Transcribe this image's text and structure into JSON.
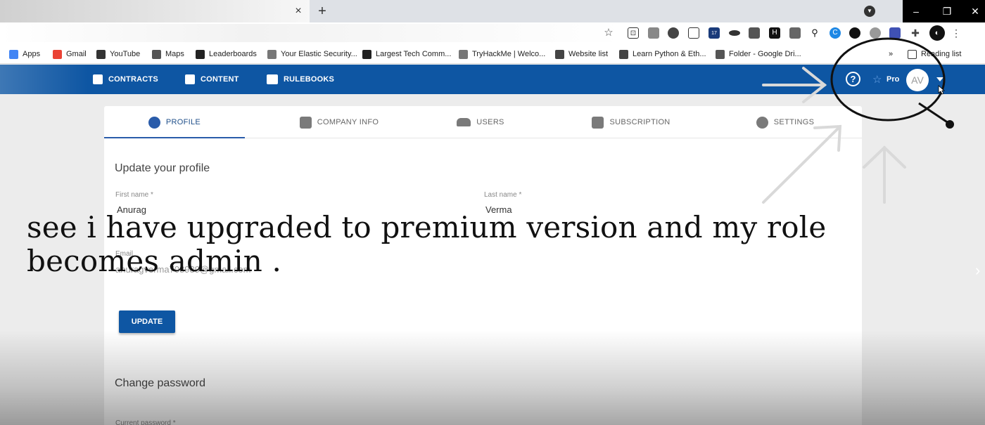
{
  "browser": {
    "tab_close": "×",
    "new_tab": "+",
    "bookmarks": [
      {
        "label": "Apps",
        "icon": "apps-icon",
        "color": "#4285f4"
      },
      {
        "label": "Gmail",
        "icon": "gmail-icon",
        "color": "#ea4335"
      },
      {
        "label": "YouTube",
        "icon": "youtube-icon",
        "color": "#333333"
      },
      {
        "label": "Maps",
        "icon": "maps-icon",
        "color": "#555555"
      },
      {
        "label": "Leaderboards",
        "icon": "h1-icon",
        "color": "#222222"
      },
      {
        "label": "Your Elastic Security...",
        "icon": "elastic-icon",
        "color": "#777777"
      },
      {
        "label": "Largest Tech Comm...",
        "icon": "tg-icon",
        "color": "#222222"
      },
      {
        "label": "TryHackMe | Welco...",
        "icon": "tryhackme-icon",
        "color": "#777777"
      },
      {
        "label": "Website list",
        "icon": "globe-icon",
        "color": "#444444"
      },
      {
        "label": "Learn Python & Eth...",
        "icon": "udemy-icon",
        "color": "#444444"
      },
      {
        "label": "Folder - Google Dri...",
        "icon": "drive-icon",
        "color": "#555555"
      }
    ],
    "bookmarks_overflow": "»",
    "reading_list": "Reading list",
    "extension_badge": "17"
  },
  "header": {
    "nav": [
      {
        "label": "CONTRACTS",
        "icon": "document-icon"
      },
      {
        "label": "CONTENT",
        "icon": "list-icon"
      },
      {
        "label": "RULEBOOKS",
        "icon": "book-icon"
      }
    ],
    "help": "?",
    "plan": "Pro",
    "avatar_initials": "AV"
  },
  "tabs": [
    {
      "label": "PROFILE",
      "icon": "account-circle-icon",
      "active": true
    },
    {
      "label": "COMPANY INFO",
      "icon": "building-icon",
      "active": false
    },
    {
      "label": "USERS",
      "icon": "users-icon",
      "active": false
    },
    {
      "label": "SUBSCRIPTION",
      "icon": "wallet-icon",
      "active": false
    },
    {
      "label": "SETTINGS",
      "icon": "gear-icon",
      "active": false
    }
  ],
  "profile": {
    "section_title": "Update your profile",
    "first_name_label": "First name *",
    "first_name": "Anurag",
    "last_name_label": "Last name *",
    "last_name": "Verma",
    "email_label": "Email",
    "email": "anuragverma708989@gmail.com",
    "update_button": "UPDATE"
  },
  "password": {
    "section_title": "Change password",
    "current_label": "Current password *"
  },
  "caption": "see i have upgraded to premium version and my role becomes admin ."
}
